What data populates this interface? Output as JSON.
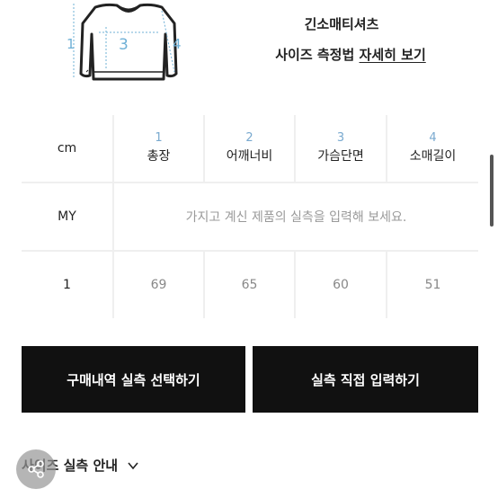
{
  "product": {
    "name": "긴소매티셔츠",
    "size_guide_prefix": "사이즈 측정법",
    "size_guide_link": "자세히 보기"
  },
  "diagram": {
    "labels": [
      "1",
      "3",
      "4"
    ]
  },
  "table": {
    "corner": "cm",
    "columns": [
      {
        "num": "1",
        "label": "총장"
      },
      {
        "num": "2",
        "label": "어깨너비"
      },
      {
        "num": "3",
        "label": "가슴단면"
      },
      {
        "num": "4",
        "label": "소매길이"
      }
    ],
    "my_row_label": "MY",
    "my_row_message": "가지고 계신 제품의 실측을 입력해 보세요.",
    "rows": [
      {
        "size": "1",
        "values": [
          "69",
          "65",
          "60",
          "51"
        ]
      }
    ]
  },
  "buttons": {
    "purchase_history": "구매내역 실측 선택하기",
    "direct_input": "실측 직접 입력하기"
  },
  "guide": {
    "label": "사이즈 실측 안내"
  },
  "icons": {
    "share": "share-icon",
    "chevron": "chevron-down-icon"
  },
  "colors": {
    "accent_blue": "#79a9cf",
    "button_bg": "#111111"
  }
}
